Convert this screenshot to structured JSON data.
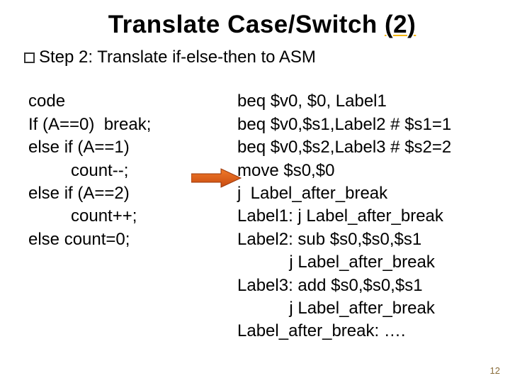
{
  "title_plain": "Translate Case/Switch ",
  "title_under": "(2)",
  "step_heading": "Step 2: Translate if-else-then to ASM",
  "left": {
    "lines": [
      "code",
      "If (A==0)  break;",
      "else if (A==1)",
      "         count--;",
      "else if (A==2)",
      "         count++;",
      "else count=0;"
    ]
  },
  "right": {
    "lines": [
      "beq $v0, $0, Label1",
      "beq $v0,$s1,Label2 # $s1=1",
      "beq $v0,$s2,Label3 # $s2=2",
      "move $s0,$0",
      "j  Label_after_break",
      "Label1: j Label_after_break",
      "Label2: sub $s0,$s0,$s1",
      "           j Label_after_break",
      "Label3: add $s0,$s0,$s1",
      "           j Label_after_break",
      "Label_after_break: …."
    ]
  },
  "page_number": "12"
}
